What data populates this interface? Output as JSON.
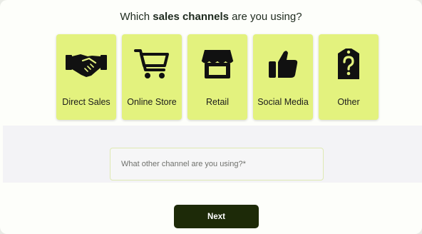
{
  "question": {
    "prefix": "Which ",
    "emphasis": "sales channels",
    "suffix": " are you using?"
  },
  "channels": [
    {
      "label": "Direct Sales",
      "icon": "handshake-icon"
    },
    {
      "label": "Online Store",
      "icon": "shopping-cart-icon"
    },
    {
      "label": "Retail",
      "icon": "storefront-icon"
    },
    {
      "label": "Social Media",
      "icon": "thumbs-up-icon"
    },
    {
      "label": "Other",
      "icon": "question-tag-icon"
    }
  ],
  "other_channel": {
    "placeholder": "What other channel are you using?*",
    "value": ""
  },
  "next_label": "Next",
  "colors": {
    "tile": "#e3f27e",
    "button": "#1d2a08",
    "page": "#fdfefa",
    "band": "#f3f3f6"
  }
}
